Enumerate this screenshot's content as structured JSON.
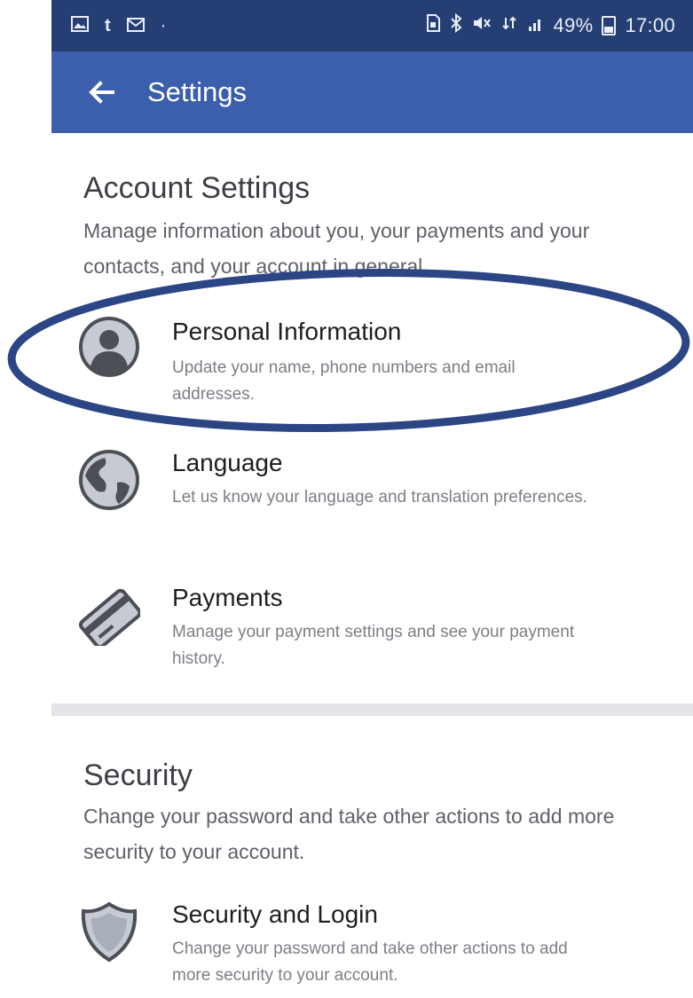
{
  "status_bar": {
    "left_icons": [
      "image-icon",
      "tumblr-icon",
      "mail-icon",
      "dot-icon"
    ],
    "right_icons": [
      "sim-icon",
      "bluetooth-icon",
      "mute-icon",
      "network-4g-icon",
      "signal-icon"
    ],
    "battery_percent": "49%",
    "time": "17:00"
  },
  "app_bar": {
    "title": "Settings",
    "back_icon": "arrow-left-icon"
  },
  "account_section": {
    "title": "Account Settings",
    "description": "Manage information about you, your payments and your contacts, and your account in general.",
    "items": [
      {
        "title": "Personal Information",
        "description": "Update your name, phone numbers and email addresses.",
        "icon": "person-icon"
      },
      {
        "title": "Language",
        "description": "Let us know your language and translation preferences.",
        "icon": "globe-icon"
      },
      {
        "title": "Payments",
        "description": "Manage your payment settings and see your payment history.",
        "icon": "credit-card-icon"
      }
    ]
  },
  "security_section": {
    "title": "Security",
    "description": "Change your password and take other actions to add more security to your account.",
    "items": [
      {
        "title": "Security and Login",
        "description": "Change your password and take other actions to add more security to your account.",
        "icon": "shield-icon"
      }
    ]
  },
  "colors": {
    "status_bar": "#253f75",
    "app_bar": "#3b5fad",
    "annotation": "#2b4585"
  }
}
